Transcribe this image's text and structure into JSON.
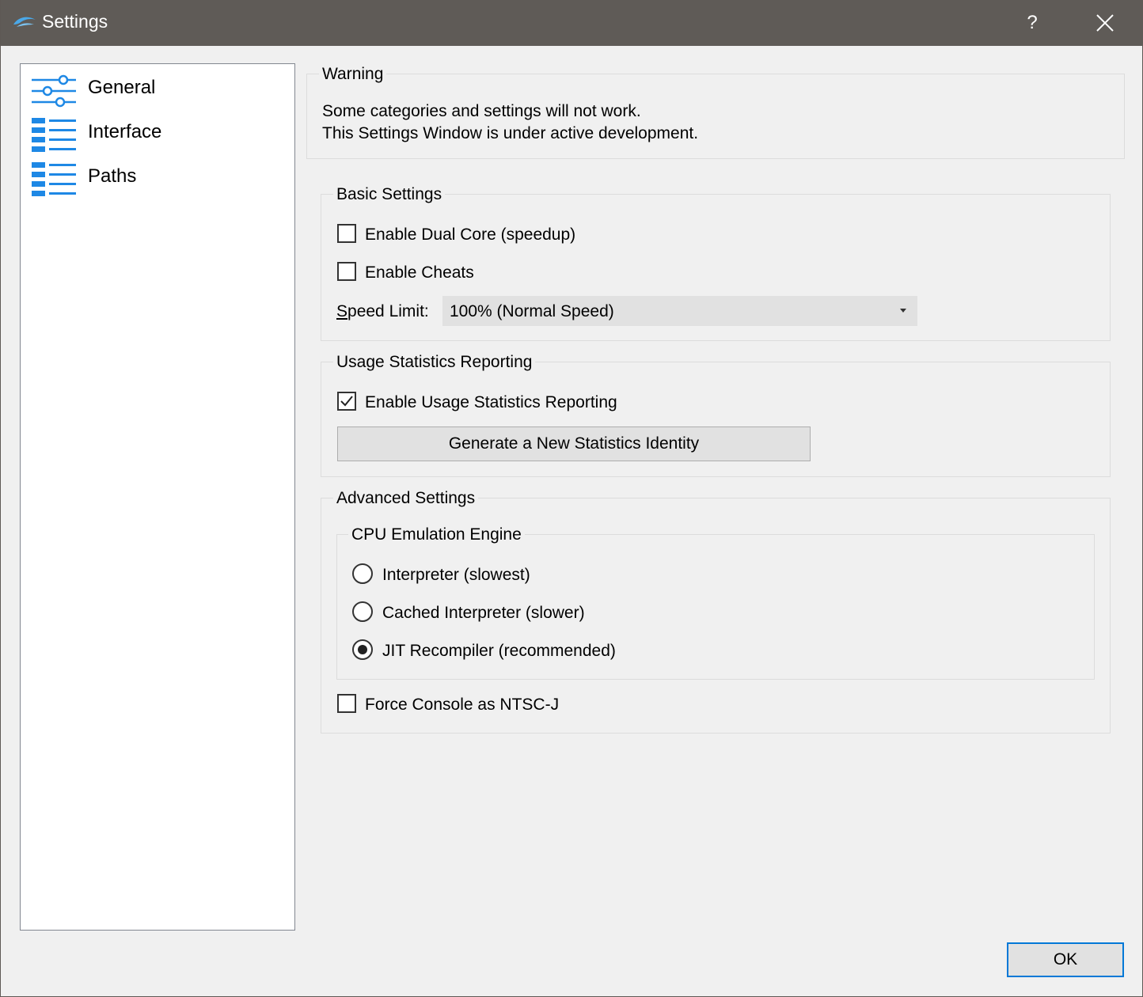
{
  "window": {
    "title": "Settings",
    "help_label": "?",
    "ok_label": "OK"
  },
  "nav": {
    "items": [
      {
        "label": "General",
        "icon": "sliders-icon"
      },
      {
        "label": "Interface",
        "icon": "list-icon"
      },
      {
        "label": "Paths",
        "icon": "list-icon"
      }
    ]
  },
  "warning": {
    "title": "Warning",
    "line1": "Some categories and settings will not work.",
    "line2": "This Settings Window is under active development."
  },
  "basic": {
    "title": "Basic Settings",
    "dual_core": {
      "label": "Enable Dual Core (speedup)",
      "checked": false
    },
    "cheats": {
      "label": "Enable Cheats",
      "checked": false
    },
    "speed_limit_label_first": "S",
    "speed_limit_label_rest": "peed Limit:",
    "speed_limit_value": "100% (Normal Speed)"
  },
  "usage": {
    "title": "Usage Statistics Reporting",
    "enable": {
      "label": "Enable Usage Statistics Reporting",
      "checked": true
    },
    "generate_button": "Generate a New Statistics Identity"
  },
  "advanced": {
    "title": "Advanced Settings",
    "cpu_title": "CPU Emulation Engine",
    "engines": [
      {
        "label": "Interpreter (slowest)",
        "selected": false
      },
      {
        "label": "Cached Interpreter (slower)",
        "selected": false
      },
      {
        "label": "JIT Recompiler (recommended)",
        "selected": true
      }
    ],
    "ntsc_j": {
      "label": "Force Console as NTSC-J",
      "checked": false
    }
  },
  "colors": {
    "titlebar": "#5f5b57",
    "accent": "#0078d7",
    "icon_blue": "#1e88e5"
  }
}
